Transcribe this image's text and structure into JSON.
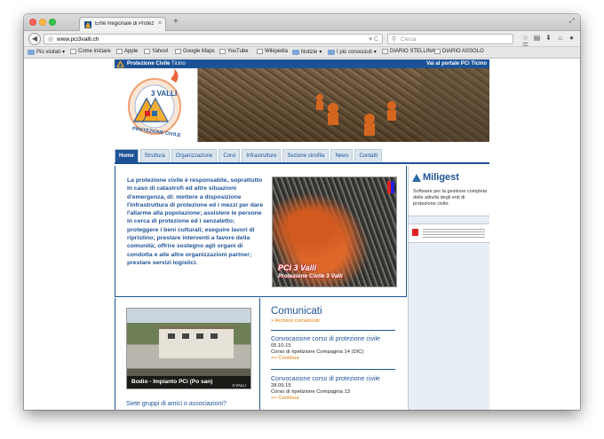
{
  "browser": {
    "tab_title": "Ente Regionale di Protezio...",
    "url_host": "www.pci3valli.ch",
    "search_placeholder": "Cerca",
    "bookmarks": [
      "Più visitati",
      "Come iniziare",
      "Apple",
      "Yahoo!",
      "Google Maps",
      "YouTube",
      "Wikipedia",
      "Notizie",
      "I più conosciuti",
      "DIARIO STELLINA",
      "DIARIO ASSOLO"
    ]
  },
  "site": {
    "brand_bold": "Protezione Civile",
    "brand_light": "Ticino",
    "portal_link": "Vai al portale PCi Ticino",
    "logo_text": "3 VALLI",
    "logo_ring": "PROTEZIONE CIVILE",
    "menu": [
      "Home",
      "Struttura",
      "Organizzazione",
      "Corsi",
      "Infrastrutture",
      "Sezione cinofila",
      "News",
      "Contatti"
    ],
    "intro": "La protezione civile è responsabile, soprattutto in caso di catastrofi ed altre situazioni d'emergenza, di: mettere a disposizione l'infrastruttura di protezione ed i mezzi per dare l'allarme alla popolazione;  assistere le persone in cerca di protezione ed i senzatetto; proteggere i beni culturali; eseguire lavori di ripristino; prestare interventi a favore della comunità; offrire sostegno agli organi di condotta e alle altre organizzazioni partner; prestare servizi logistici.",
    "feature_caption": "PCi 3 Valli",
    "feature_caption2": "Protezione Civile 3 Valli",
    "bodio_caption": "Bodio - Impianto PCi (Po san)",
    "bodio_logo": "3 VALLI",
    "groups_link": "Siete gruppi di amici o associazioni?",
    "comunicati": {
      "heading": "Comunicati",
      "archive": "> Archivio comunicati",
      "items": [
        {
          "title": "Convocazione corso di protezione civile",
          "date": "05.10.15",
          "desc": "Corso di ripetizione Compagnia 14 (DIC)",
          "more": ">> Continua"
        },
        {
          "title": "Convocazione corso di protezione civile",
          "date": "28.09.15",
          "desc": "Corso di ripetizione Compagnia 13",
          "more": ">> Continua"
        }
      ]
    },
    "sidebar": {
      "miligest_name": "Miligest",
      "miligest_desc": "Software per la gestione completa delle attività degli enti di protezione civile."
    }
  }
}
